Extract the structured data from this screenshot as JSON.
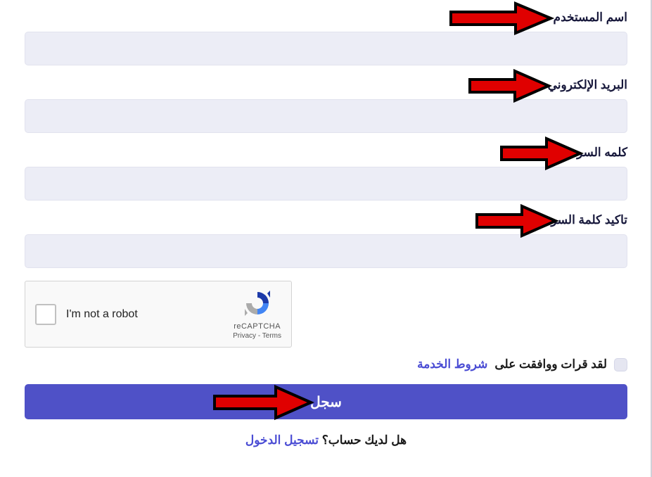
{
  "fields": {
    "username": {
      "label": "اسم المستخدم",
      "value": ""
    },
    "email": {
      "label": "البريد الإلكتروني",
      "value": ""
    },
    "password": {
      "label": "كلمه السر",
      "value": ""
    },
    "confirm": {
      "label": "تاكيد كلمة السر",
      "value": ""
    }
  },
  "captcha": {
    "label": "I'm not a robot",
    "brand": "reCAPTCHA",
    "privacy": "Privacy",
    "terms": "Terms",
    "sep": " - "
  },
  "terms": {
    "text": "لقد قرات ووافقت على",
    "link": "شروط الخدمة"
  },
  "submit": "سجل",
  "bottom": {
    "question": "هل لديك حساب؟",
    "login": "تسجيل الدخول"
  }
}
